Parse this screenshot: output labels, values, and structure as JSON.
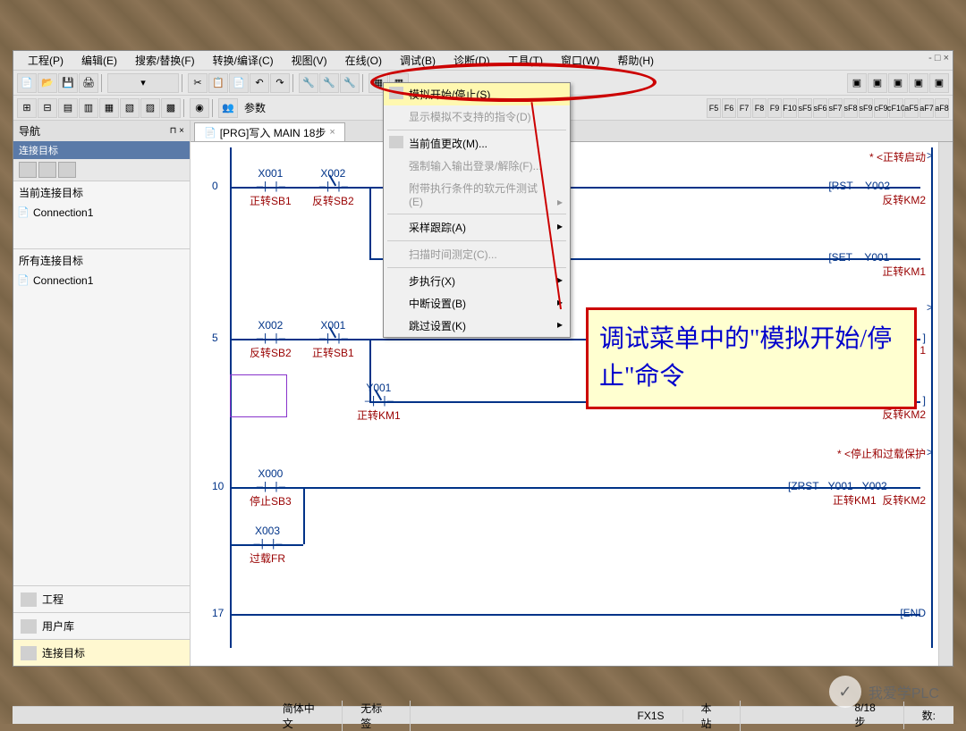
{
  "menubar": {
    "items": [
      "工程(P)",
      "编辑(E)",
      "搜索/替换(F)",
      "转换/编译(C)",
      "视图(V)",
      "在线(O)",
      "调试(B)",
      "诊断(D)",
      "工具(T)",
      "窗口(W)",
      "帮助(H)"
    ],
    "window_ctl": "- □ ×"
  },
  "toolbar2": {
    "params_label": "参数"
  },
  "nav": {
    "title": "导航",
    "pin": "⊓ ×",
    "tab_strip": "连接目标",
    "current_target": "当前连接目标",
    "connection": "Connection1",
    "all_targets": "所有连接目标",
    "bottom": {
      "project": "工程",
      "userlib": "用户库",
      "conntarget": "连接目标"
    }
  },
  "tab": {
    "label": "[PRG]写入 MAIN 18步"
  },
  "ladder": {
    "step0": "0",
    "step5": "5",
    "step10": "10",
    "step17": "17",
    "x000": "X000",
    "x000_lbl": "停止SB3",
    "x001": "X001",
    "x001_lbl": "正转SB1",
    "x002": "X002",
    "x002_lbl": "反转SB2",
    "x003": "X003",
    "x003_lbl": "过载FR",
    "y001": "Y001",
    "y001_lbl": "正转KM1",
    "y002": "Y002",
    "y002_lbl": "反转KM2",
    "comment_forward": "* <正转启动",
    "comment_stop": "* <停止和过载保护",
    "rst": "RST",
    "set": "SET",
    "zrst": "ZRST",
    "end": "END",
    "bracket_open": "[",
    "bracket_close": "]",
    "gt": ">"
  },
  "dropdown": {
    "items": [
      {
        "label": "模拟开始/停止(S)",
        "hl": true,
        "icon": true
      },
      {
        "label": "显示模拟不支持的指令(D)",
        "disabled": true
      },
      {
        "sep": true
      },
      {
        "label": "当前值更改(M)...",
        "icon": true
      },
      {
        "label": "强制输入输出登录/解除(F)...",
        "disabled": true
      },
      {
        "label": "附带执行条件的软元件测试(E)",
        "arrow": true,
        "disabled": true
      },
      {
        "sep": true
      },
      {
        "label": "采样跟踪(A)",
        "arrow": true
      },
      {
        "sep": true
      },
      {
        "label": "扫描时间测定(C)...",
        "disabled": true
      },
      {
        "sep": true
      },
      {
        "label": "步执行(X)",
        "arrow": true
      },
      {
        "label": "中断设置(B)",
        "arrow": true
      },
      {
        "label": "跳过设置(K)",
        "arrow": true
      }
    ]
  },
  "annotation": "调试菜单中的\"模拟开始/停止\"命令",
  "statusbar": {
    "lang": "简体中文",
    "tag": "无标签",
    "plc": "FX1S",
    "station": "本站",
    "step": "8/18步",
    "mode": "数:"
  },
  "watermark": "我爱学PLC"
}
